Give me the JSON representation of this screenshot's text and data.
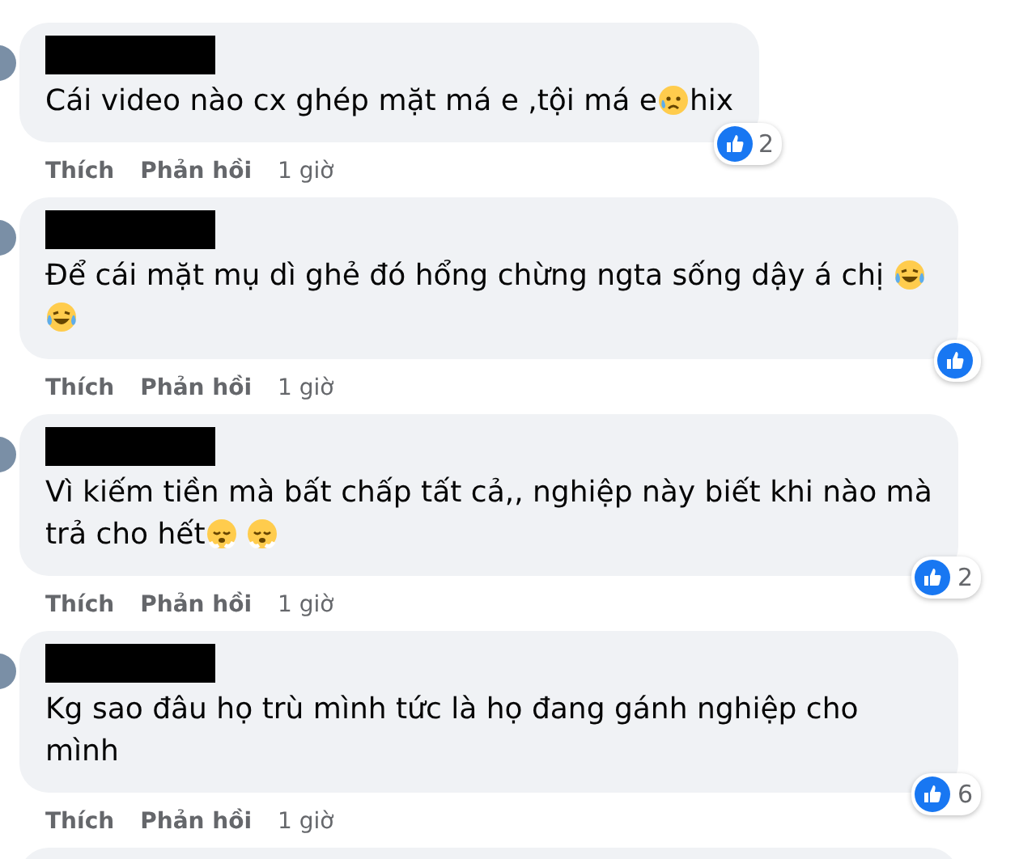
{
  "comments": [
    {
      "segments": [
        {
          "kind": "text",
          "text": "Cái video nào cx ghép mặt má e ,tội má e"
        },
        {
          "kind": "sad-emoji"
        },
        {
          "kind": "text",
          "text": "hix"
        }
      ],
      "reaction_count": "2",
      "actions": {
        "like": "Thích",
        "reply": "Phản hồi",
        "time": "1 giờ"
      }
    },
    {
      "segments": [
        {
          "kind": "text",
          "text": "Để cái mặt mụ dì ghẻ đó hổng chừng ngta sống dậy á chị "
        },
        {
          "kind": "laugh-emoji"
        },
        {
          "kind": "laugh-emoji"
        }
      ],
      "actions": {
        "like": "Thích",
        "reply": "Phản hồi",
        "time": "1 giờ"
      }
    },
    {
      "segments": [
        {
          "kind": "text",
          "text": "Vì kiếm tiền mà bất chấp tất cả,, nghiệp này biết khi nào mà trả cho hết"
        },
        {
          "kind": "steam-emoji"
        },
        {
          "kind": "steam-emoji"
        }
      ],
      "reaction_count": "2",
      "actions": {
        "like": "Thích",
        "reply": "Phản hồi",
        "time": "1 giờ"
      }
    },
    {
      "segments": [
        {
          "kind": "text",
          "text": "Kg sao đâu họ trù mình tức là họ đang gánh nghiệp cho mình"
        }
      ],
      "reaction_count": "6",
      "actions": {
        "like": "Thích",
        "reply": "Phản hồi",
        "time": "1 giờ"
      }
    }
  ]
}
